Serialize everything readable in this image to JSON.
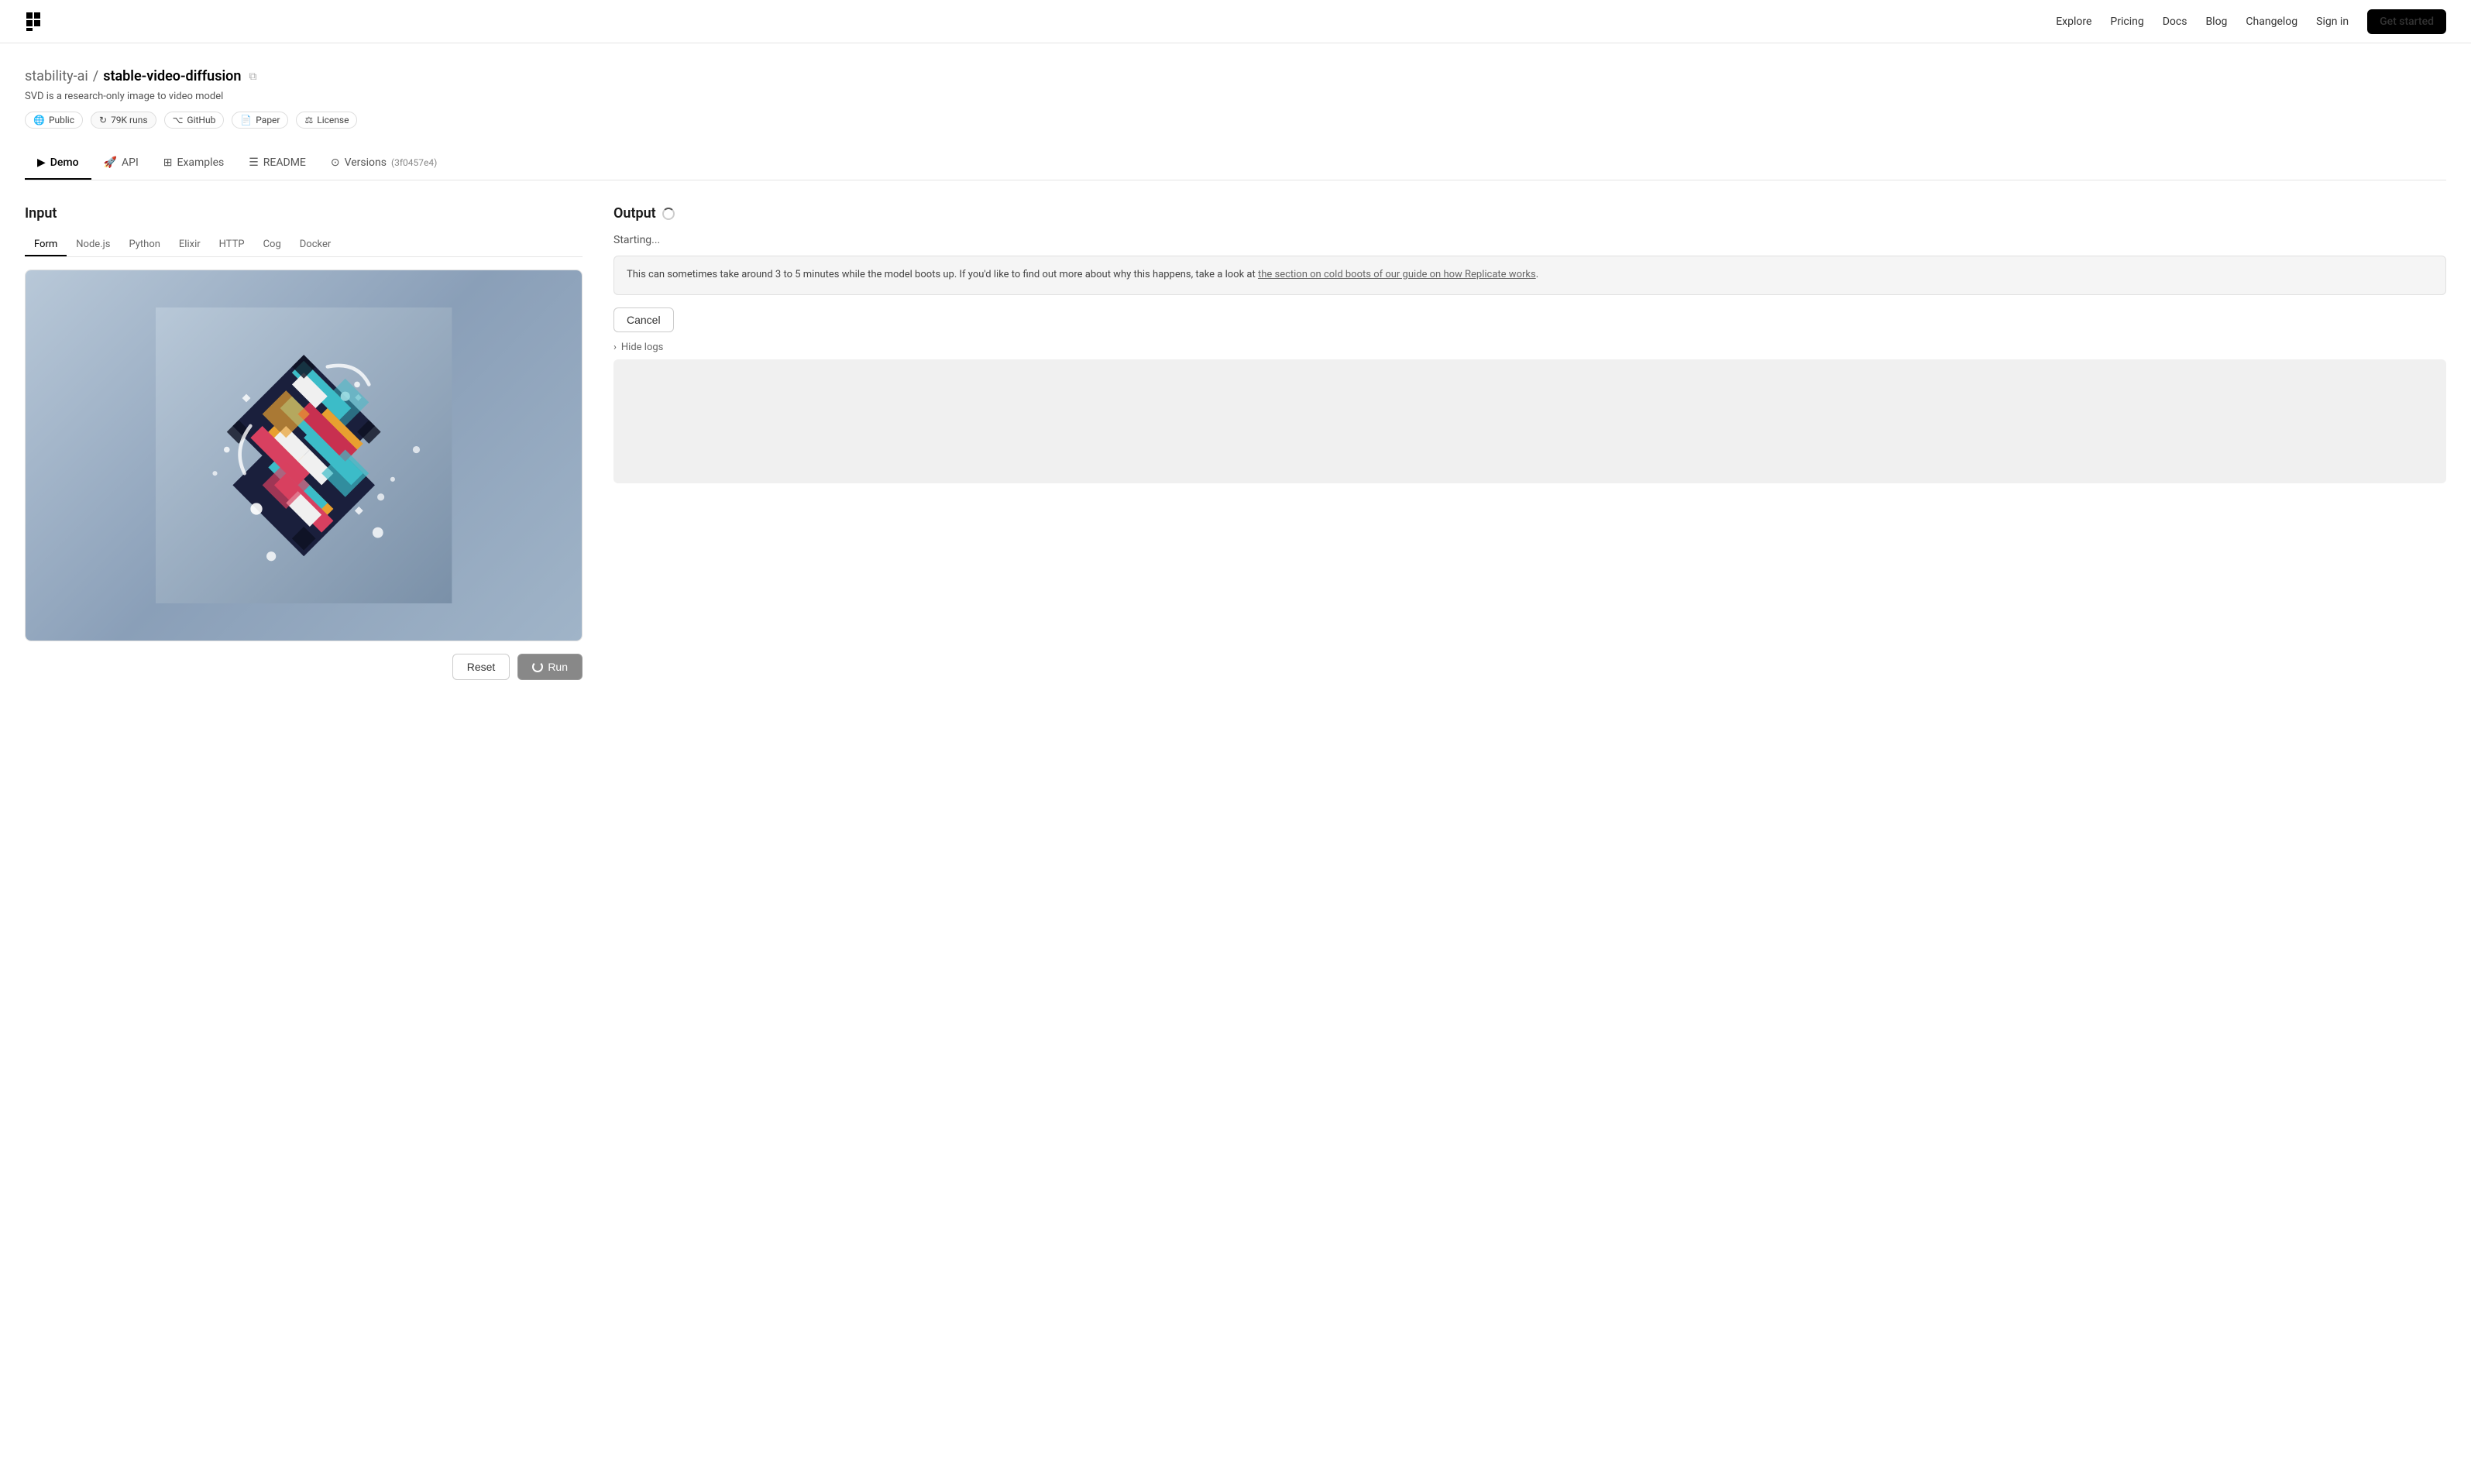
{
  "nav": {
    "logo_alt": "Replicate logo",
    "links": [
      {
        "label": "Explore",
        "href": "#"
      },
      {
        "label": "Pricing",
        "href": "#"
      },
      {
        "label": "Docs",
        "href": "#"
      },
      {
        "label": "Blog",
        "href": "#"
      },
      {
        "label": "Changelog",
        "href": "#"
      }
    ],
    "signin_label": "Sign in",
    "get_started_label": "Get started"
  },
  "model": {
    "org": "stability-ai",
    "separator": "/",
    "name": "stable-video-diffusion",
    "description": "SVD is a research-only image to video model",
    "badges": [
      {
        "icon": "globe-icon",
        "label": "Public"
      },
      {
        "icon": "runs-icon",
        "label": "79K runs"
      },
      {
        "icon": "github-icon",
        "label": "GitHub"
      },
      {
        "icon": "paper-icon",
        "label": "Paper"
      },
      {
        "icon": "license-icon",
        "label": "License"
      }
    ]
  },
  "tabs": [
    {
      "id": "demo",
      "icon": "play-icon",
      "label": "Demo",
      "active": true
    },
    {
      "id": "api",
      "icon": "api-icon",
      "label": "API",
      "active": false
    },
    {
      "id": "examples",
      "icon": "examples-icon",
      "label": "Examples",
      "active": false
    },
    {
      "id": "readme",
      "icon": "readme-icon",
      "label": "README",
      "active": false
    },
    {
      "id": "versions",
      "icon": "versions-icon",
      "label": "Versions",
      "version": "(3f0457e4)",
      "active": false
    }
  ],
  "input": {
    "title": "Input",
    "code_tabs": [
      {
        "id": "form",
        "label": "Form",
        "active": true
      },
      {
        "id": "nodejs",
        "label": "Node.js",
        "active": false
      },
      {
        "id": "python",
        "label": "Python",
        "active": false
      },
      {
        "id": "elixir",
        "label": "Elixir",
        "active": false
      },
      {
        "id": "http",
        "label": "HTTP",
        "active": false
      },
      {
        "id": "cog",
        "label": "Cog",
        "active": false
      },
      {
        "id": "docker",
        "label": "Docker",
        "active": false
      }
    ],
    "buttons": {
      "reset_label": "Reset",
      "run_label": "Run"
    }
  },
  "output": {
    "title": "Output",
    "status": "Starting...",
    "info_text": "This can sometimes take around 3 to 5 minutes while the model boots up. If you'd like to find out more about why this happens, take a look at",
    "info_link_text": "the section on cold boots of our guide on how Replicate works",
    "cancel_label": "Cancel",
    "logs_label": "Hide logs"
  },
  "colors": {
    "accent": "#000000",
    "border": "#e5e5e5",
    "bg_muted": "#f5f5f5"
  }
}
